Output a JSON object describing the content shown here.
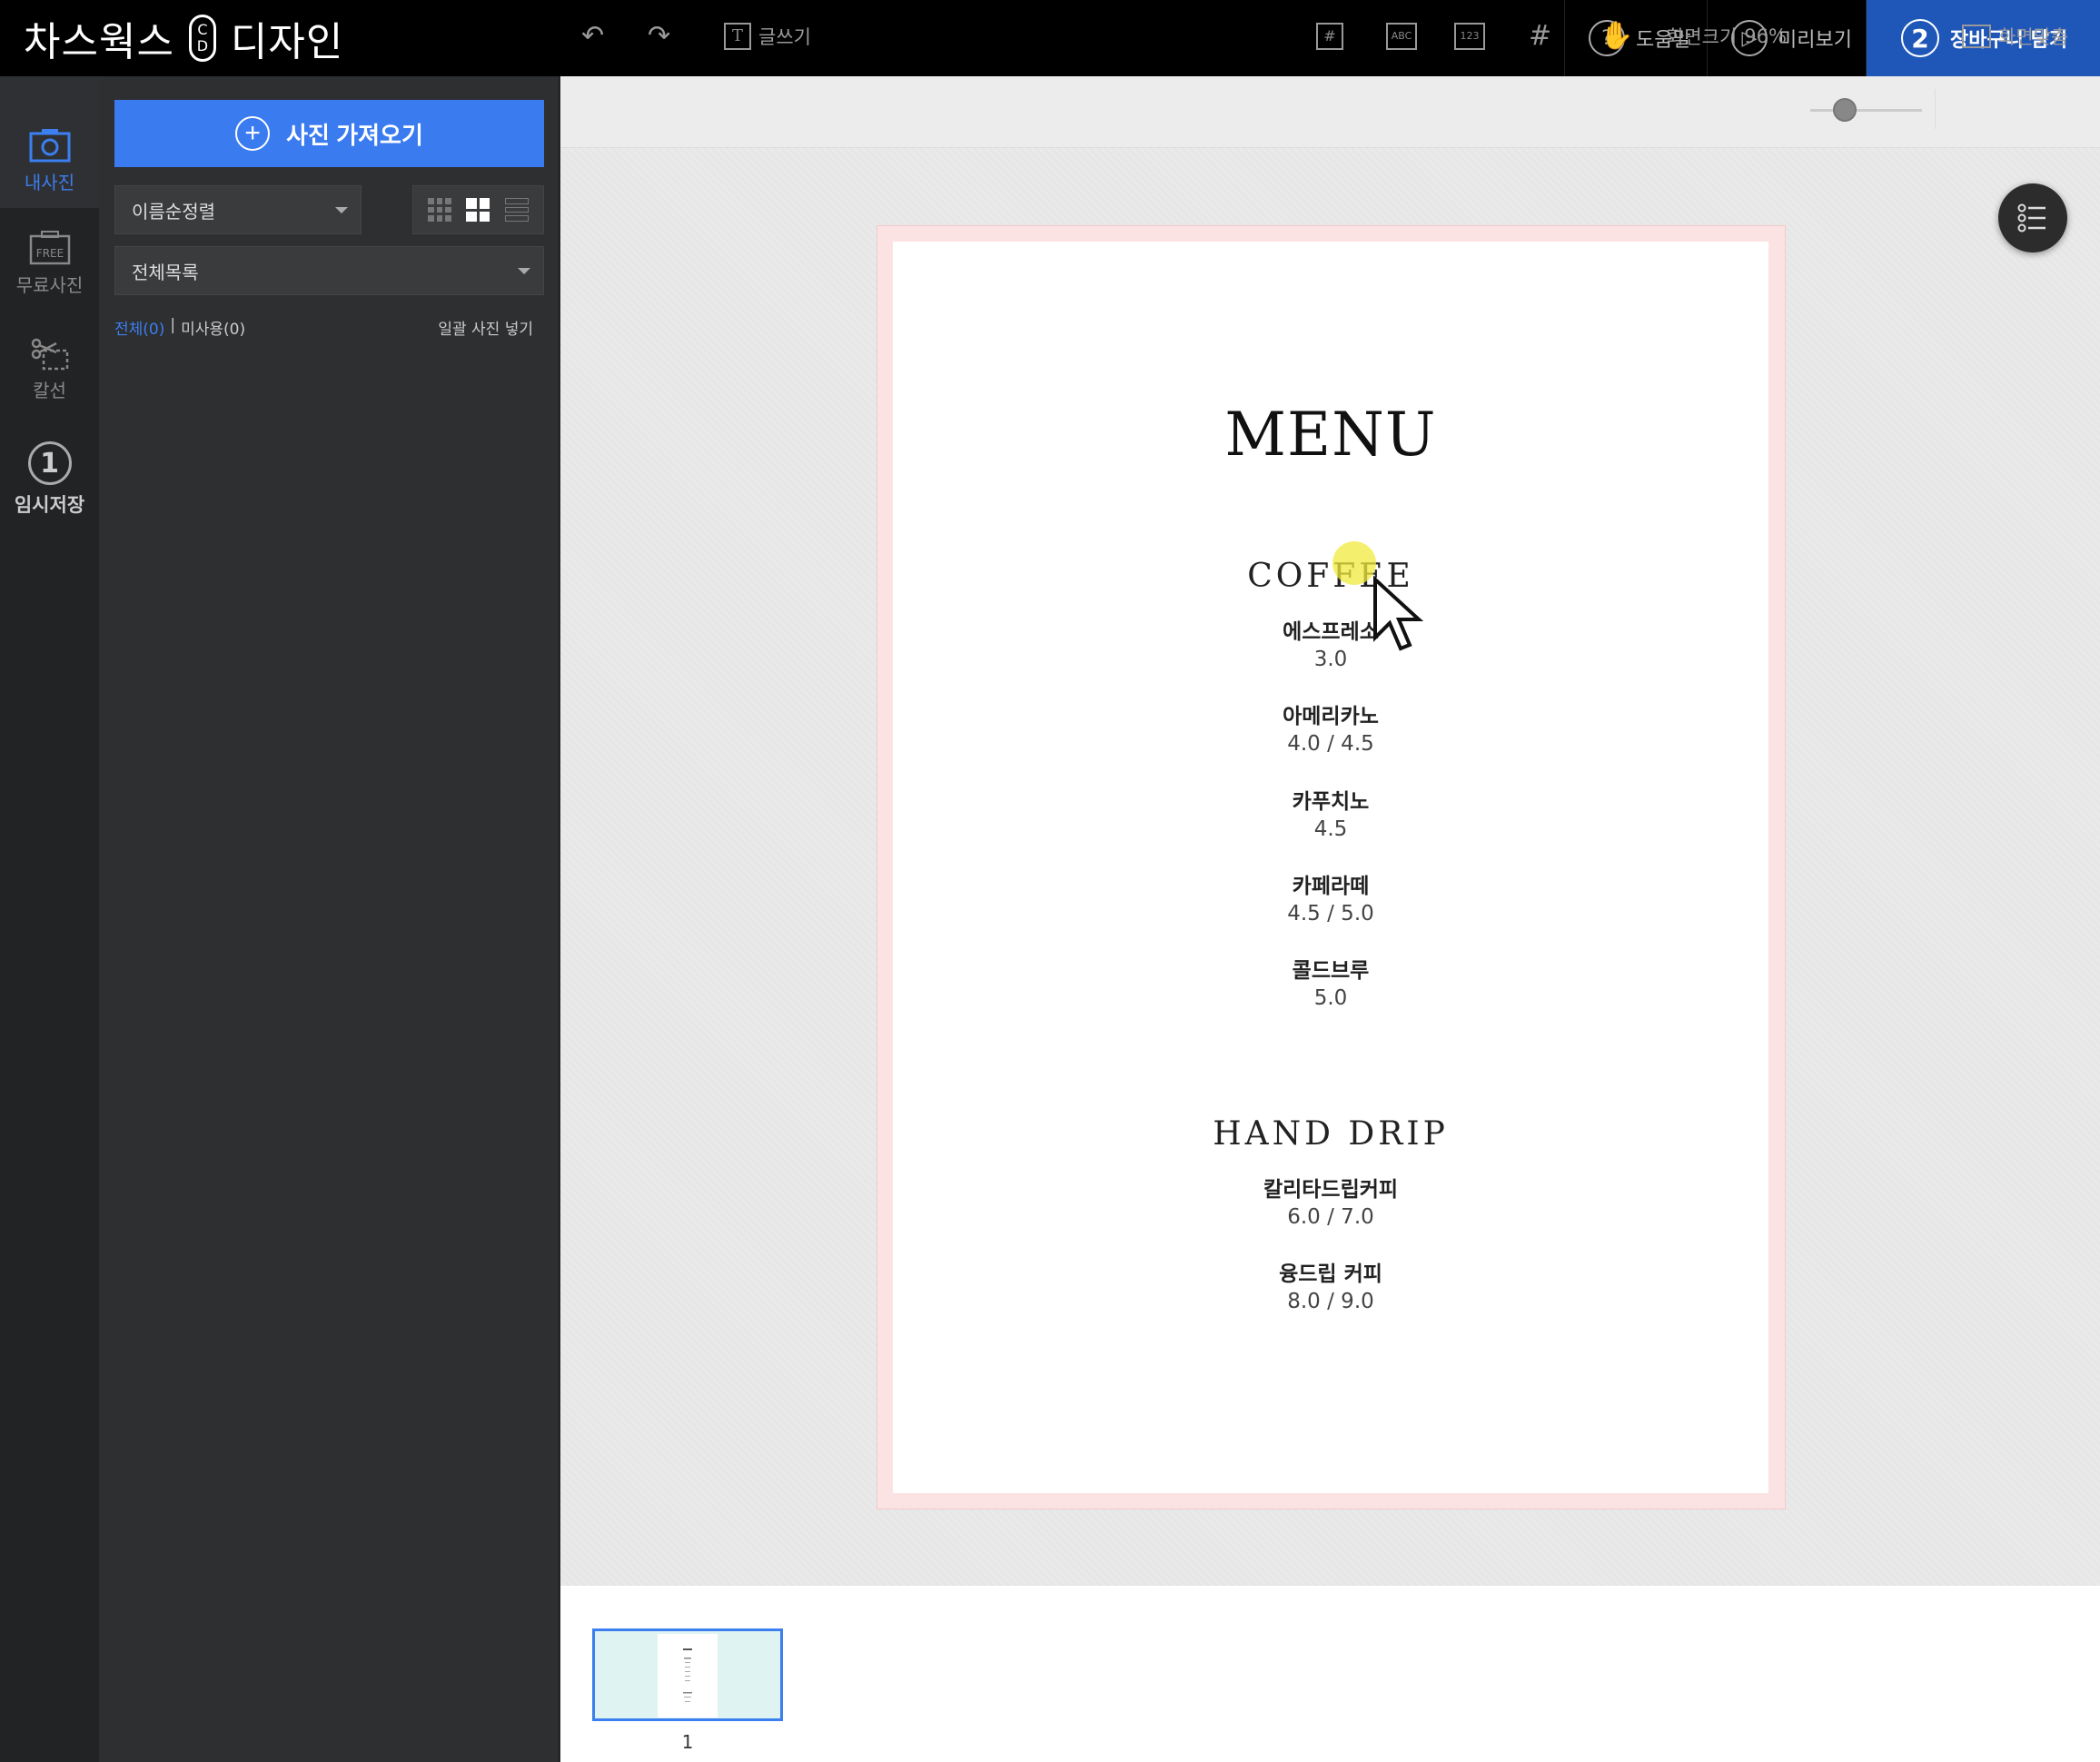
{
  "header": {
    "brand_left": "차스웍스",
    "brand_logo_top": "C",
    "brand_logo_bottom": "D",
    "brand_right": "디자인",
    "help_label": "도움말",
    "help_icon": "?",
    "preview_label": "미리보기",
    "preview_icon": "▷",
    "cart_step": "2",
    "cart_label": "장바구니 담기"
  },
  "rail": {
    "my_photos": "내사진",
    "free_photos": "무료사진",
    "free_badge": "FREE",
    "cutline": "칼선",
    "temp_save_step": "1",
    "temp_save": "임시저장"
  },
  "panel": {
    "import_label": "사진 가져오기",
    "sort_value": "이름순정렬",
    "list_value": "전체목록",
    "filter_all": "전체(0)",
    "filter_sep": "|",
    "filter_unused": "미사용(0)",
    "bulk_insert": "일괄 사진 넣기"
  },
  "toolbar": {
    "write_label": "글쓰기",
    "abc_label": "ABC",
    "num_label": "123",
    "zoom_label": "화면크기",
    "zoom_value": "96%",
    "fit_label": "화면맞춤"
  },
  "menu": {
    "title": "MENU",
    "coffee_title": "COFFEE",
    "coffee": [
      {
        "name": "에스프레소",
        "price": "3.0"
      },
      {
        "name": "아메리카노",
        "price": "4.0 / 4.5"
      },
      {
        "name": "카푸치노",
        "price": "4.5"
      },
      {
        "name": "카페라떼",
        "price": "4.5 / 5.0"
      },
      {
        "name": "콜드브루",
        "price": "5.0"
      }
    ],
    "drip_title": "HAND DRIP",
    "drip": [
      {
        "name": "칼리타드립커피",
        "price": "6.0 / 7.0"
      },
      {
        "name": "융드립 커피",
        "price": "8.0 / 9.0"
      }
    ]
  },
  "pages": {
    "current_page": "1"
  },
  "colors": {
    "accent": "#3a7bf0",
    "cart_bg": "#1f57b9",
    "page_border": "#fbe3e3"
  }
}
